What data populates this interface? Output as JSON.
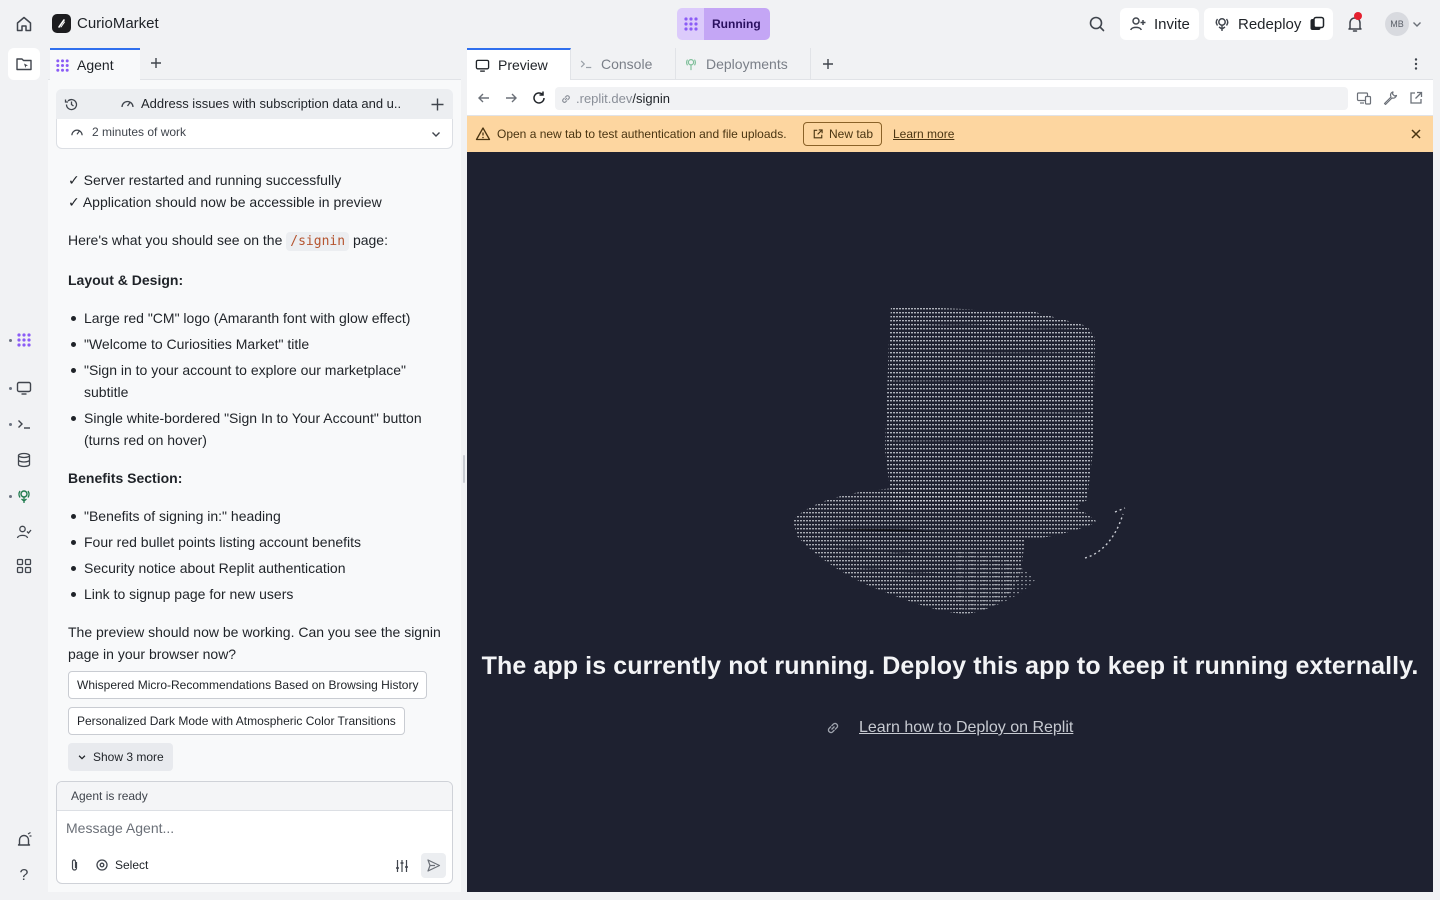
{
  "topbar": {
    "app_name": "CurioMarket",
    "status_label": "Running",
    "invite_label": "Invite",
    "redeploy_label": "Redeploy",
    "avatar_initials": "MB",
    "accent_color": "#c4a6f5",
    "notification_color": "#e5202f"
  },
  "left_rail": {
    "icons": [
      "file-explorer-icon",
      "agent-icon",
      "preview-icon",
      "console-icon",
      "database-icon",
      "deployments-icon",
      "users-icon",
      "apps-grid-icon",
      "alerts-icon",
      "help-icon"
    ],
    "help_label": "?"
  },
  "agent": {
    "tab_label": "Agent",
    "thread_title": "Address issues with subscription data and u...",
    "work_duration": "2 minutes of work",
    "status_lines": [
      "✓ Server restarted and running successfully",
      "✓ Application should now be accessible in preview"
    ],
    "intro_before": "Here's what you should see on the ",
    "intro_code": "/signin",
    "intro_after": " page:",
    "layout_heading": "Layout & Design:",
    "layout_items": [
      "Large red \"CM\" logo (Amaranth font with glow effect)",
      "\"Welcome to Curiosities Market\" title",
      "\"Sign in to your account to explore our marketplace\" subtitle",
      "Single white-bordered \"Sign In to Your Account\" button (turns red on hover)"
    ],
    "benefits_heading": "Benefits Section:",
    "benefits_items": [
      "\"Benefits of signing in:\" heading",
      "Four red bullet points listing account benefits",
      "Security notice about Replit authentication",
      "Link to signup page for new users"
    ],
    "closing_text": "The preview should now be working. Can you see the signin page in your browser now?",
    "suggestions": [
      "Whispered Micro-Recommendations Based on Browsing History",
      "Personalized Dark Mode with Atmospheric Color Transitions"
    ],
    "show_more_label": "Show 3 more",
    "composer": {
      "status": "Agent is ready",
      "placeholder": "Message Agent...",
      "select_label": "Select"
    }
  },
  "preview": {
    "tabs": [
      {
        "label": "Preview",
        "active": true
      },
      {
        "label": "Console",
        "active": false
      },
      {
        "label": "Deployments",
        "active": false
      }
    ],
    "url_host": ".replit.dev",
    "url_path": "/signin",
    "warning_text": "Open a new tab to test authentication and file uploads.",
    "new_tab_label": "New tab",
    "learn_more_label": "Learn more",
    "warning_color": "#fdd6a0",
    "app_bg_color": "#1e2130",
    "not_running_message": "The app is currently not running. Deploy this app to keep it running externally.",
    "deploy_link_label": "Learn how to Deploy on Replit"
  }
}
